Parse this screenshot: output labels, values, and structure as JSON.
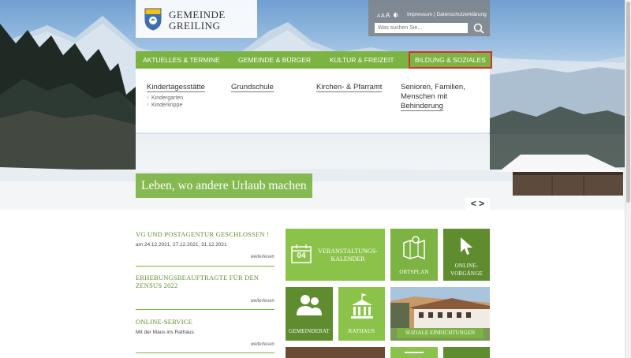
{
  "colors": {
    "green": "#7cb342",
    "dark_green": "#5e8c2e",
    "light_green": "#8bc34a",
    "highlight": "#d43030"
  },
  "logo": {
    "line1": "GEMEINDE",
    "line2": "GREILING",
    "icon": "coat-of-arms-icon"
  },
  "util": {
    "font_sizes": [
      "A",
      "A",
      "A"
    ],
    "contrast_icon": "contrast-icon",
    "impressum": "Impressum",
    "separator": "|",
    "datenschutz": "Datenschutzerklärung",
    "search_placeholder": "Was suchen Sie...",
    "search_icon": "search-icon"
  },
  "nav": [
    {
      "label": "AKTUELLES & TERMINE",
      "active": false
    },
    {
      "label": "GEMEINDE & BÜRGER",
      "active": false
    },
    {
      "label": "KULTUR & FREIZEIT",
      "active": false
    },
    {
      "label": "BILDUNG & SOZIALES",
      "active": true
    }
  ],
  "mega_menu": {
    "col1": {
      "title": "Kindertagesstätte",
      "subs": [
        "Kindergarten",
        "Kinderkrippe"
      ]
    },
    "col2": {
      "title": "Grundschule"
    },
    "col3": {
      "title": "Kirchen- & Pfarramt"
    },
    "col4": {
      "title_l1": "Senioren, Familien,",
      "title_l2": "Menschen mit",
      "title_l3": "Behinderung"
    }
  },
  "slogan": "Leben, wo andere Urlaub machen",
  "slider": {
    "prev": "<",
    "next": ">"
  },
  "news": [
    {
      "title": "VG UND POSTAGENTUR GESCHLOSSEN !",
      "body": "am 24.12.2021, 27.12.2021, 31.12.2021",
      "more": "weiterlesen"
    },
    {
      "title_l1": "ERHEBUNGSBEAUFTRAGTE FÜR DEN",
      "title_l2": "ZENSUS 2022",
      "more": "weiterlesen"
    },
    {
      "title": "ONLINE-SERVICE",
      "body": "Mit der Maus ins Rathaus",
      "more": "weiterlesen"
    }
  ],
  "tiles": {
    "calendar": {
      "day": "04",
      "l1": "VERANSTALTUNGS-",
      "l2": "KALENDER",
      "icon": "calendar-icon"
    },
    "ortsplan": {
      "label": "ORTSPLAN",
      "icon": "map-icon"
    },
    "online": {
      "l1": "ONLINE-",
      "l2": "VORGÄNGE",
      "icon": "cursor-icon"
    },
    "gemeinderat": {
      "label": "GEMEINDERAT",
      "icon": "people-icon"
    },
    "rathaus": {
      "label": "RATHAUS",
      "icon": "townhall-icon"
    },
    "soziale": {
      "label": "SOZIALE EINRICHTUNGEN"
    }
  }
}
